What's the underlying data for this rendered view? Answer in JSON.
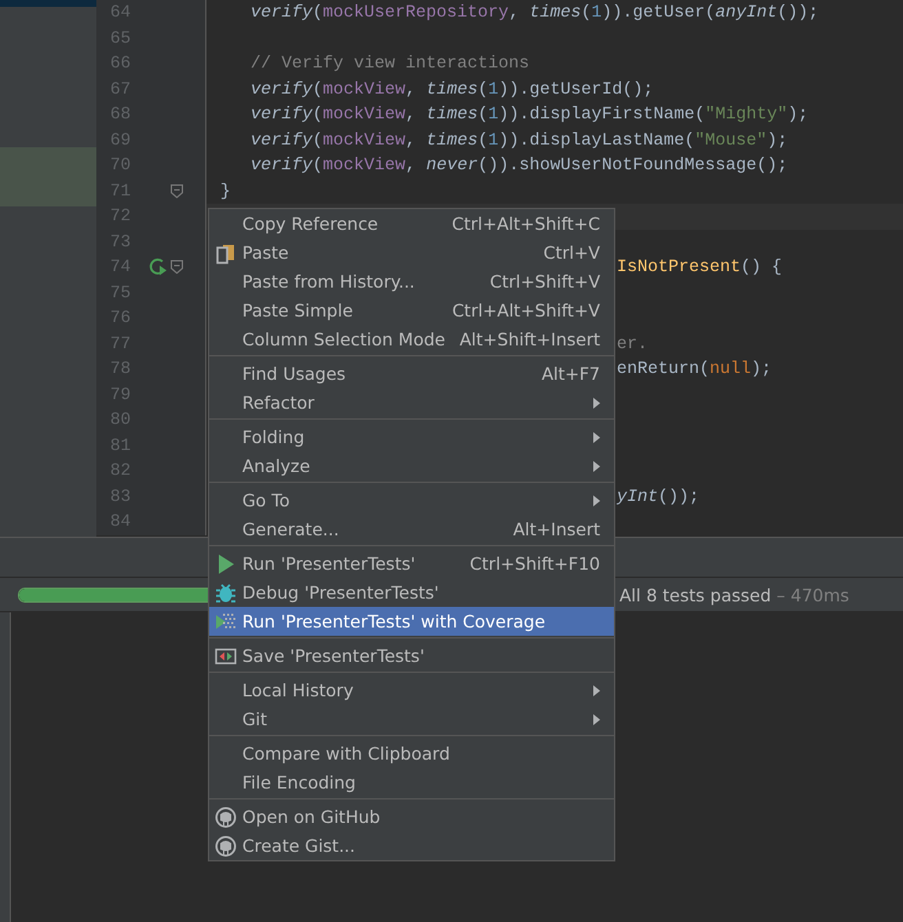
{
  "editor": {
    "lines": [
      {
        "number": "64",
        "kind": "statement",
        "segments": [
          {
            "kind": "call",
            "text": "verify"
          },
          {
            "kind": "plain",
            "text": "("
          },
          {
            "kind": "field",
            "text": "mockUserRepository"
          },
          {
            "kind": "plain",
            "text": ", "
          },
          {
            "kind": "call",
            "text": "times"
          },
          {
            "kind": "plain",
            "text": "("
          },
          {
            "kind": "number",
            "text": "1"
          },
          {
            "kind": "plain",
            "text": ")).getUser("
          },
          {
            "kind": "call",
            "text": "anyInt"
          },
          {
            "kind": "plain",
            "text": "());"
          }
        ]
      },
      {
        "number": "65",
        "kind": "statement"
      },
      {
        "number": "66",
        "kind": "statement",
        "segments": [
          {
            "kind": "comment",
            "text": "// Verify view interactions"
          }
        ]
      },
      {
        "number": "67",
        "kind": "statement",
        "segments": [
          {
            "kind": "call",
            "text": "verify"
          },
          {
            "kind": "plain",
            "text": "("
          },
          {
            "kind": "field",
            "text": "mockView"
          },
          {
            "kind": "plain",
            "text": ", "
          },
          {
            "kind": "call",
            "text": "times"
          },
          {
            "kind": "plain",
            "text": "("
          },
          {
            "kind": "number",
            "text": "1"
          },
          {
            "kind": "plain",
            "text": ")).getUserId();"
          }
        ]
      },
      {
        "number": "68",
        "kind": "statement",
        "segments": [
          {
            "kind": "call",
            "text": "verify"
          },
          {
            "kind": "plain",
            "text": "("
          },
          {
            "kind": "field",
            "text": "mockView"
          },
          {
            "kind": "plain",
            "text": ", "
          },
          {
            "kind": "call",
            "text": "times"
          },
          {
            "kind": "plain",
            "text": "("
          },
          {
            "kind": "number",
            "text": "1"
          },
          {
            "kind": "plain",
            "text": ")).displayFirstName("
          },
          {
            "kind": "string",
            "text": "\"Mighty\""
          },
          {
            "kind": "plain",
            "text": ");"
          }
        ]
      },
      {
        "number": "69",
        "kind": "statement",
        "segments": [
          {
            "kind": "call",
            "text": "verify"
          },
          {
            "kind": "plain",
            "text": "("
          },
          {
            "kind": "field",
            "text": "mockView"
          },
          {
            "kind": "plain",
            "text": ", "
          },
          {
            "kind": "call",
            "text": "times"
          },
          {
            "kind": "plain",
            "text": "("
          },
          {
            "kind": "number",
            "text": "1"
          },
          {
            "kind": "plain",
            "text": ")).displayLastName("
          },
          {
            "kind": "string",
            "text": "\"Mouse\""
          },
          {
            "kind": "plain",
            "text": ");"
          }
        ]
      },
      {
        "number": "70",
        "kind": "statement",
        "segments": [
          {
            "kind": "call",
            "text": "verify"
          },
          {
            "kind": "plain",
            "text": "("
          },
          {
            "kind": "field",
            "text": "mockView"
          },
          {
            "kind": "plain",
            "text": ", "
          },
          {
            "kind": "call",
            "text": "never"
          },
          {
            "kind": "plain",
            "text": "()).showUserNotFoundMessage();"
          }
        ]
      },
      {
        "number": "71",
        "kind": "block-end",
        "segments": [
          {
            "kind": "plain",
            "text": "}"
          }
        ]
      },
      {
        "number": "72",
        "kind": "caret-line"
      },
      {
        "number": "73",
        "kind": "plain"
      },
      {
        "number": "74",
        "kind": "test-method",
        "tail": [
          {
            "kind": "method",
            "text": "IsNotPresent"
          },
          {
            "kind": "plain",
            "text": "() {"
          }
        ]
      },
      {
        "number": "75",
        "kind": "plain"
      },
      {
        "number": "76",
        "kind": "plain"
      },
      {
        "number": "77",
        "kind": "plain",
        "tail": [
          {
            "kind": "comment",
            "text": "er."
          }
        ]
      },
      {
        "number": "78",
        "kind": "plain",
        "tail": [
          {
            "kind": "plain",
            "text": "enReturn("
          },
          {
            "kind": "keyword",
            "text": "null"
          },
          {
            "kind": "plain",
            "text": ");"
          }
        ]
      },
      {
        "number": "79",
        "kind": "plain"
      },
      {
        "number": "80",
        "kind": "plain"
      },
      {
        "number": "81",
        "kind": "plain"
      },
      {
        "number": "82",
        "kind": "plain"
      },
      {
        "number": "83",
        "kind": "plain",
        "tail": [
          {
            "kind": "call",
            "text": "yInt"
          },
          {
            "kind": "plain",
            "text": "());"
          }
        ]
      },
      {
        "number": "84",
        "kind": "plain"
      }
    ]
  },
  "test_runner": {
    "progress": {
      "level": 1
    },
    "status": "All 8 tests passed",
    "duration": "– 470ms"
  },
  "context_menu": {
    "groups": [
      [
        {
          "kind": "plain",
          "label": "Copy Reference",
          "shortcut": "Ctrl+Alt+Shift+C",
          "submenu": false,
          "selected": false
        },
        {
          "kind": "paste",
          "label": "Paste",
          "shortcut": "Ctrl+V",
          "submenu": false,
          "selected": false
        },
        {
          "kind": "plain",
          "label": "Paste from History...",
          "shortcut": "Ctrl+Shift+V",
          "submenu": false,
          "selected": false
        },
        {
          "kind": "plain",
          "label": "Paste Simple",
          "shortcut": "Ctrl+Alt+Shift+V",
          "submenu": false,
          "selected": false
        },
        {
          "kind": "plain",
          "label": "Column Selection Mode",
          "shortcut": "Alt+Shift+Insert",
          "submenu": false,
          "selected": false
        }
      ],
      [
        {
          "kind": "plain",
          "label": "Find Usages",
          "shortcut": "Alt+F7",
          "submenu": false,
          "selected": false
        },
        {
          "kind": "plain",
          "label": "Refactor",
          "submenu": true,
          "selected": false
        }
      ],
      [
        {
          "kind": "plain",
          "label": "Folding",
          "submenu": true,
          "selected": false
        },
        {
          "kind": "plain",
          "label": "Analyze",
          "submenu": true,
          "selected": false
        }
      ],
      [
        {
          "kind": "plain",
          "label": "Go To",
          "submenu": true,
          "selected": false
        },
        {
          "kind": "plain",
          "label": "Generate...",
          "shortcut": "Alt+Insert",
          "submenu": false,
          "selected": false
        }
      ],
      [
        {
          "kind": "run",
          "label": "Run 'PresenterTests'",
          "shortcut": "Ctrl+Shift+F10",
          "submenu": false,
          "selected": false
        },
        {
          "kind": "debug",
          "label": "Debug 'PresenterTests'",
          "submenu": false,
          "selected": false
        },
        {
          "kind": "coverage",
          "label": "Run 'PresenterTests' with Coverage",
          "submenu": false,
          "selected": true
        }
      ],
      [
        {
          "kind": "save",
          "label": "Save 'PresenterTests'",
          "submenu": false,
          "selected": false
        }
      ],
      [
        {
          "kind": "plain",
          "label": "Local History",
          "submenu": true,
          "selected": false
        },
        {
          "kind": "plain",
          "label": "Git",
          "submenu": true,
          "selected": false
        }
      ],
      [
        {
          "kind": "plain",
          "label": "Compare with Clipboard",
          "submenu": false,
          "selected": false
        },
        {
          "kind": "plain",
          "label": "File Encoding",
          "submenu": false,
          "selected": false
        }
      ],
      [
        {
          "kind": "github",
          "label": "Open on GitHub",
          "submenu": false,
          "selected": false
        },
        {
          "kind": "github",
          "label": "Create Gist...",
          "submenu": false,
          "selected": false
        }
      ]
    ]
  }
}
